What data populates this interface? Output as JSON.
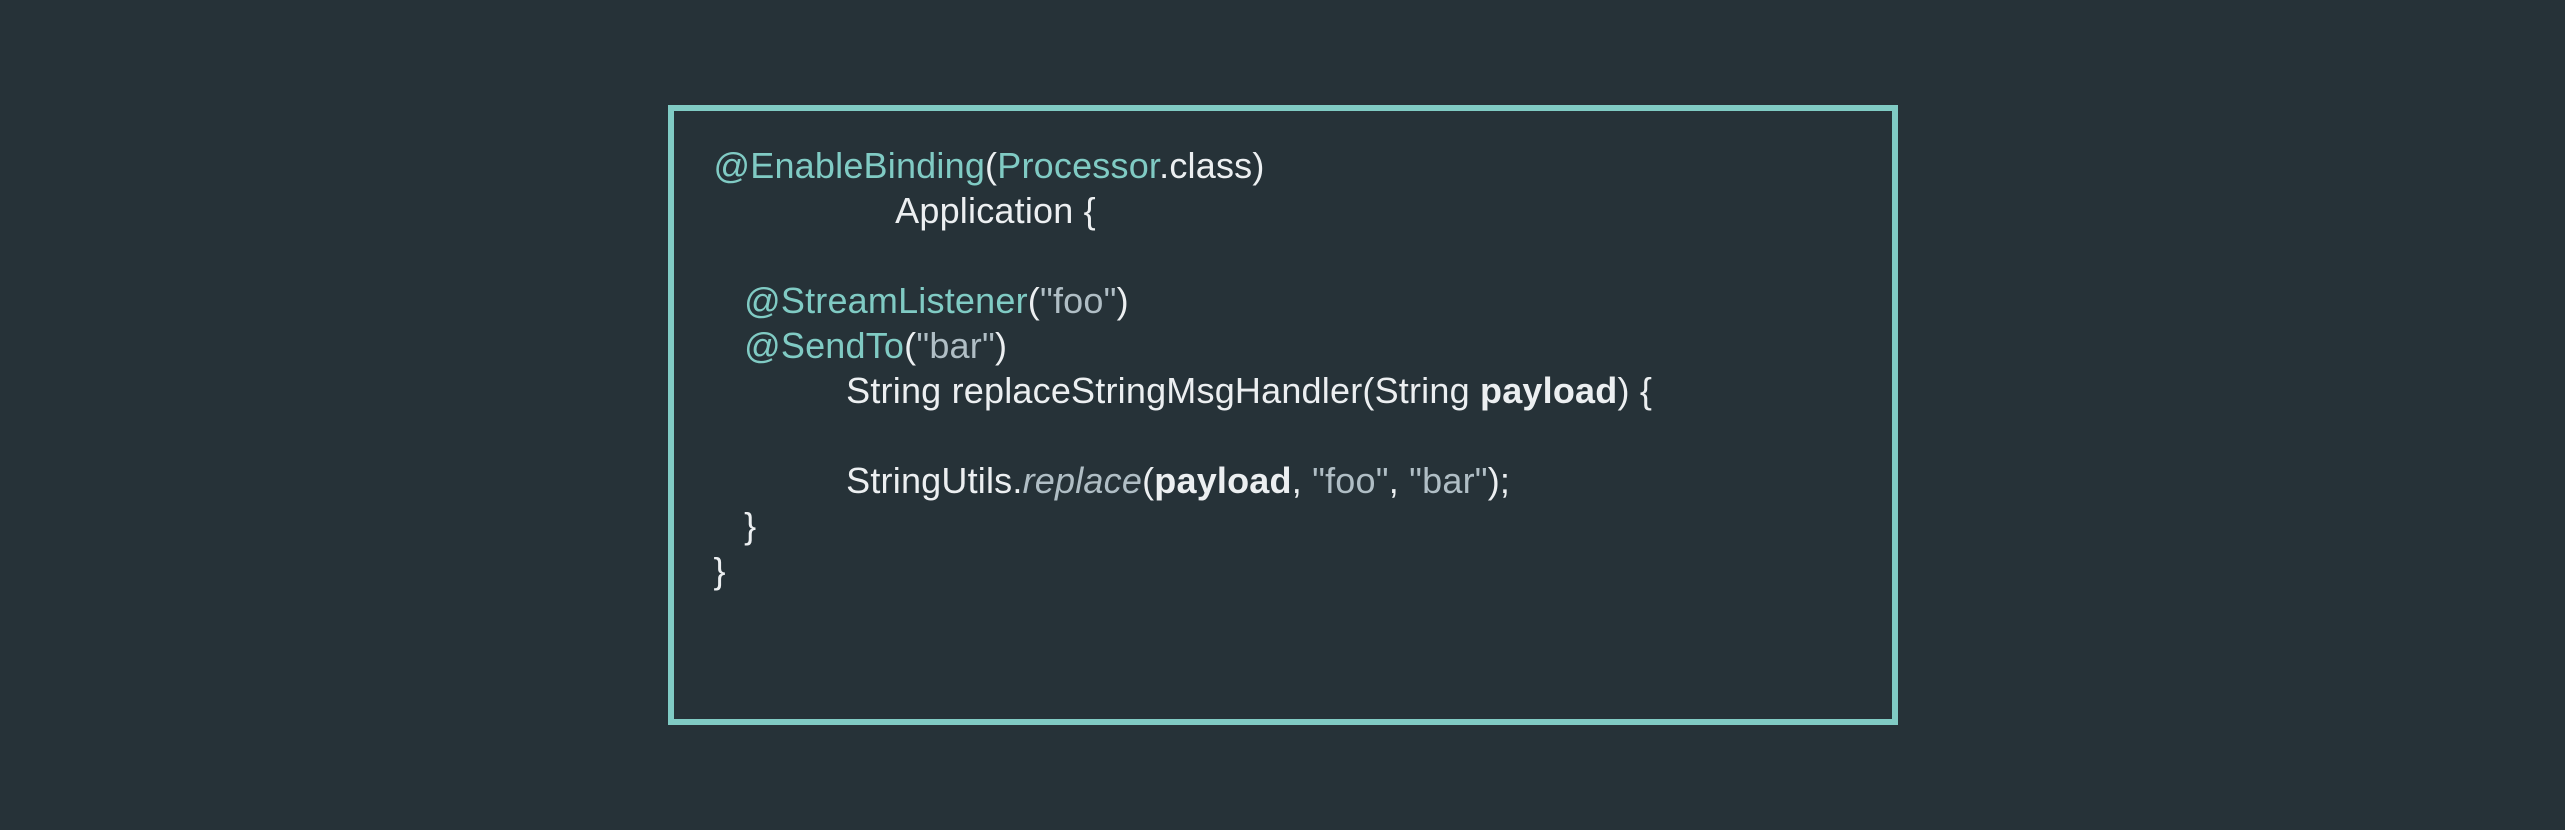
{
  "code": {
    "line1": {
      "ann": "@EnableBinding",
      "open": "(",
      "type": "Processor",
      "tail": ".class)"
    },
    "line2": {
      "indent": "                  ",
      "text": "Application {"
    },
    "line3": "",
    "line4": {
      "indent": "   ",
      "ann": "@StreamListener",
      "open": "(",
      "str": "\"foo\"",
      "close": ")"
    },
    "line5": {
      "indent": "   ",
      "ann": "@SendTo",
      "open": "(",
      "str": "\"bar\"",
      "close": ")"
    },
    "line6": {
      "indent": "             ",
      "pre": "String replaceStringMsgHandler(String ",
      "bold": "payload",
      "post": ") {"
    },
    "line7": "",
    "line8": {
      "indent": "             ",
      "pre": "StringUtils.",
      "it": "replace",
      "open": "(",
      "bold": "payload",
      "tail": ", ",
      "str1": "\"foo\"",
      "comma": ", ",
      "str2": "\"bar\"",
      "close": ");"
    },
    "line9": {
      "indent": "   ",
      "text": "}"
    },
    "line10": {
      "text": "}"
    }
  }
}
